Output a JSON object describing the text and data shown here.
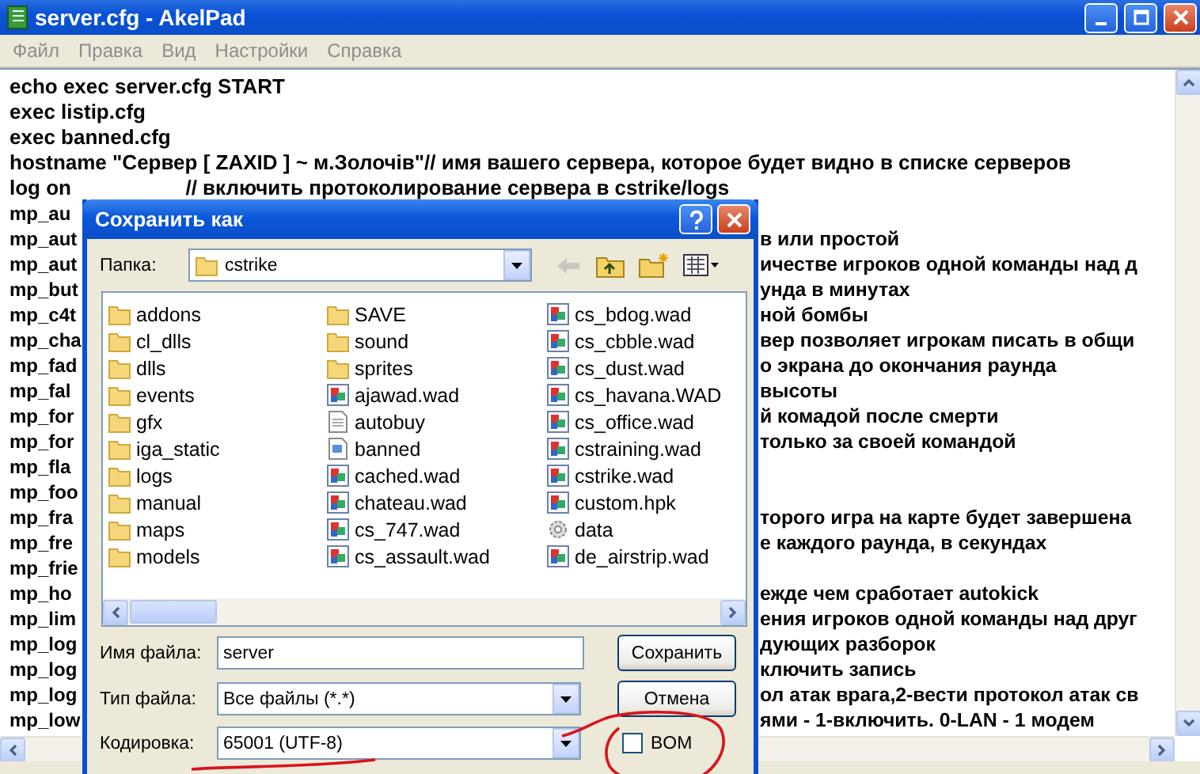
{
  "window": {
    "title": "server.cfg - AkelPad"
  },
  "menu": [
    "Файл",
    "Правка",
    "Вид",
    "Настройки",
    "Справка"
  ],
  "editor": {
    "lines": [
      {
        "text": "echo exec server.cfg START"
      },
      {
        "text": "exec listip.cfg"
      },
      {
        "text": "exec banned.cfg"
      },
      {
        "text": "hostname \"Сервер [ ZAXID ] ~ м.Золочів\"// имя вашего сервера, которое будет видно в списке серверов"
      },
      {
        "text": "log on                    // включить протоколирование сервера в cstrike/logs"
      },
      {
        "left": "mp_au"
      },
      {
        "left": "mp_aut",
        "right": "в или простой"
      },
      {
        "left": "mp_aut",
        "right": "ичестве игроков одной команды над д"
      },
      {
        "left": "mp_but",
        "right": "унда в минутах"
      },
      {
        "left": "mp_c4t",
        "right": "ной бомбы"
      },
      {
        "left": "mp_cha",
        "right": "вер позволяет игрокам писать в общи"
      },
      {
        "left": "mp_fad",
        "right": "о экрана до окончания раунда"
      },
      {
        "left": "mp_fal",
        "right": "высоты"
      },
      {
        "left": "mp_for",
        "right": "й комадой после смерти"
      },
      {
        "left": "mp_for",
        "right": "только за своей командой"
      },
      {
        "left": "mp_fla"
      },
      {
        "left": "mp_foo"
      },
      {
        "left": "mp_fra",
        "right": "торого игра на карте будет завершена"
      },
      {
        "left": "mp_fre",
        "right": "е каждого раунда, в секундах"
      },
      {
        "left": "mp_frie"
      },
      {
        "left": "mp_ho",
        "right": "ежде чем сработает autokick"
      },
      {
        "left": "mp_lim",
        "right": "ения игроков одной команды над друг"
      },
      {
        "left": "mp_log",
        "right": "дующих разборок"
      },
      {
        "left": "mp_log",
        "right": "ключить запись"
      },
      {
        "left": "mp_log",
        "right": "ол атак врага,2-вести протокол атак св"
      },
      {
        "left": "mp_low",
        "right": "ями - 1-включить. 0-LAN - 1 модем"
      }
    ]
  },
  "dialog": {
    "title": "Сохранить как",
    "folder_label": "Папка:",
    "folder": "cstrike",
    "files": [
      {
        "name": "addons",
        "kind": "folder"
      },
      {
        "name": "cl_dlls",
        "kind": "folder"
      },
      {
        "name": "dlls",
        "kind": "folder"
      },
      {
        "name": "events",
        "kind": "folder"
      },
      {
        "name": "gfx",
        "kind": "folder"
      },
      {
        "name": "iga_static",
        "kind": "folder"
      },
      {
        "name": "logs",
        "kind": "folder"
      },
      {
        "name": "manual",
        "kind": "folder"
      },
      {
        "name": "maps",
        "kind": "folder"
      },
      {
        "name": "models",
        "kind": "folder"
      },
      {
        "name": "SAVE",
        "kind": "folder"
      },
      {
        "name": "sound",
        "kind": "folder"
      },
      {
        "name": "sprites",
        "kind": "folder"
      },
      {
        "name": "ajawad.wad",
        "kind": "wad"
      },
      {
        "name": "autobuy",
        "kind": "text"
      },
      {
        "name": "banned",
        "kind": "doc"
      },
      {
        "name": "cached.wad",
        "kind": "wad"
      },
      {
        "name": "chateau.wad",
        "kind": "wad"
      },
      {
        "name": "cs_747.wad",
        "kind": "wad"
      },
      {
        "name": "cs_assault.wad",
        "kind": "wad"
      },
      {
        "name": "cs_bdog.wad",
        "kind": "wad"
      },
      {
        "name": "cs_cbble.wad",
        "kind": "wad"
      },
      {
        "name": "cs_dust.wad",
        "kind": "wad"
      },
      {
        "name": "cs_havana.WAD",
        "kind": "wad"
      },
      {
        "name": "cs_office.wad",
        "kind": "wad"
      },
      {
        "name": "cstraining.wad",
        "kind": "wad"
      },
      {
        "name": "cstrike.wad",
        "kind": "wad"
      },
      {
        "name": "custom.hpk",
        "kind": "wad"
      },
      {
        "name": "data",
        "kind": "settings"
      },
      {
        "name": "de_airstrip.wad",
        "kind": "wad"
      }
    ],
    "filename_label": "Имя файла:",
    "filename": "server",
    "filetype_label": "Тип файла:",
    "filetype": "Все файлы (*.*)",
    "encoding_label": "Кодировка:",
    "encoding": "65001 (UTF-8)",
    "bom": {
      "label": "BOM",
      "checked": false
    },
    "buttons": [
      "Сохранить",
      "Отмена"
    ]
  }
}
